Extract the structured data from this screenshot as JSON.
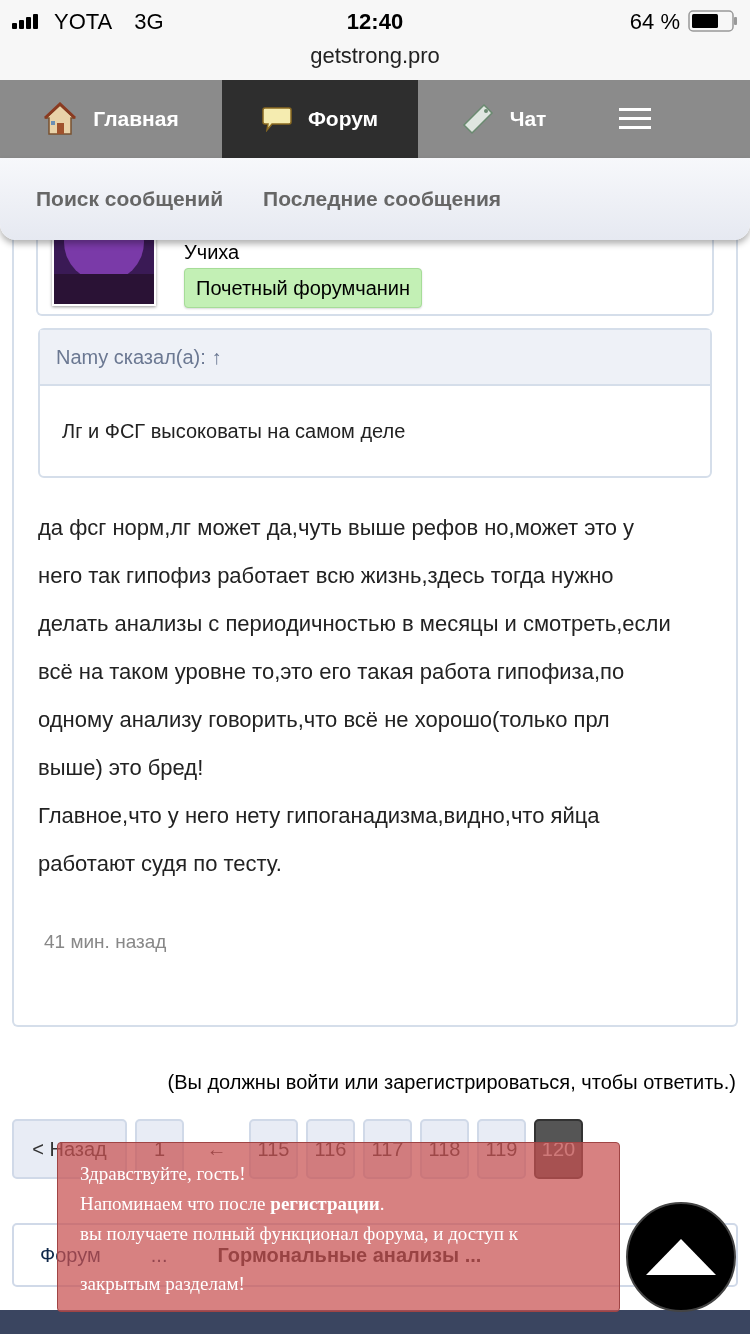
{
  "status_bar": {
    "carrier": "YOTA",
    "network": "3G",
    "time": "12:40",
    "battery": "64 %"
  },
  "address_bar": {
    "url": "getstrong.pro"
  },
  "nav_tabs": [
    {
      "label": "Главная",
      "kind": "house",
      "selected": false
    },
    {
      "label": "Форум",
      "kind": "bubble",
      "selected": true
    },
    {
      "label": "Чат",
      "kind": "tag",
      "selected": false
    },
    {
      "kind": "menu",
      "selected": false
    }
  ],
  "sub_nav": [
    "Поиск сообщений",
    "Последние сообщения"
  ],
  "post": {
    "author": {
      "name": "Учиха",
      "title": "Почетный форумчанин"
    },
    "quote": {
      "header": "Namy сказал(а): ↑",
      "text": "Лг и ФСГ высоковаты на самом деле"
    },
    "paragraphs": [
      "да фсг норм,лг может да,чуть выше рефов но,может это у него так гипофиз работает всю жизнь,здесь тогда нужно делать анализы с периодичностью в месяцы и смотреть,если всё на таком уровне то,это его такая работа гипофиза,по одному анализу говорить,что всё не хорошо(только прл выше) это бред!",
      "Главное,что у него нету гипоганадизма,видно,что яйца работают судя по тесту."
    ],
    "time": "41 мин. назад"
  },
  "login_note": "(Вы должны войти или зарегистрироваться, чтобы ответить.)",
  "pagination": [
    {
      "label": "< Назад",
      "kind": "prev",
      "selected": false
    },
    {
      "label": "1",
      "kind": "page",
      "selected": false
    },
    {
      "label": "←",
      "kind": "jump",
      "selected": false
    },
    {
      "label": "115",
      "kind": "page",
      "selected": false
    },
    {
      "label": "116",
      "kind": "page",
      "selected": false
    },
    {
      "label": "117",
      "kind": "page",
      "selected": false
    },
    {
      "label": "118",
      "kind": "page",
      "selected": false
    },
    {
      "label": "119",
      "kind": "page",
      "selected": false
    },
    {
      "label": "120",
      "kind": "page",
      "selected": true
    }
  ],
  "breadcrumb": [
    {
      "label": "Форум",
      "current": false
    },
    {
      "label": "...",
      "current": false
    },
    {
      "label": "Гормональные анализы ...",
      "current": true
    }
  ],
  "guest_popup": {
    "lines": [
      "Здравствуйте, гость!",
      "Напоминаем что после **регистрации**.",
      "вы получаете полный функционал форума, и доступ к",
      "закрытым разделам!"
    ]
  }
}
